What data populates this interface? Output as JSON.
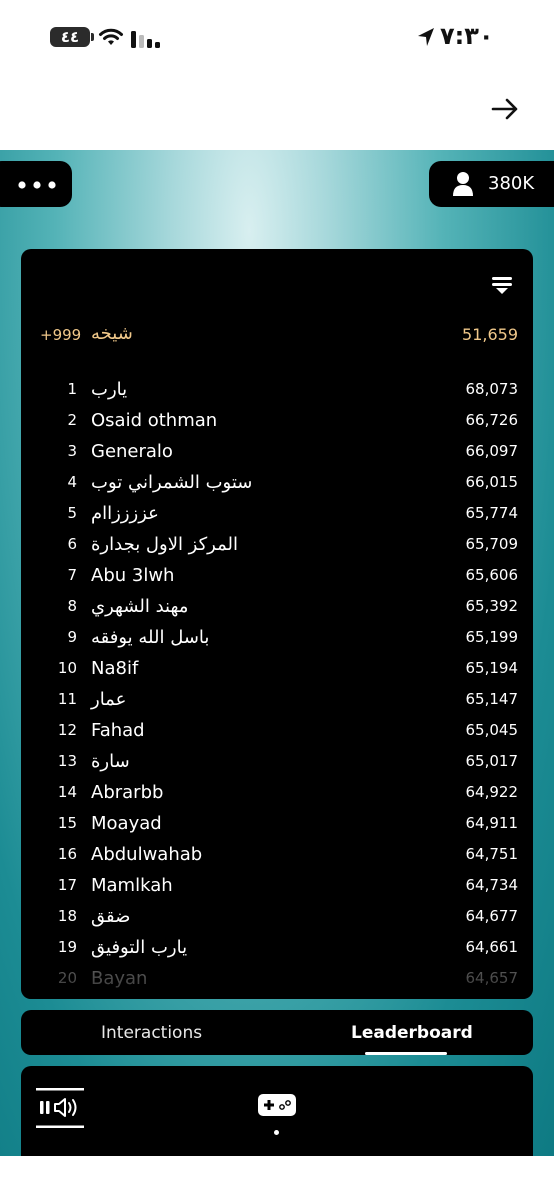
{
  "status_bar": {
    "battery": "٤٤",
    "time": "٧:٣٠"
  },
  "nav": {
    "forward_icon": "arrow-right-icon"
  },
  "header": {
    "more_icon": "ellipsis-icon",
    "coins_icon": "user-icon",
    "coins": "380K"
  },
  "leaderboard": {
    "sort_icon": "sort-filter-icon",
    "me": {
      "rank": "+999",
      "name": "شيخه",
      "score": "51,659"
    },
    "rows": [
      {
        "rank": "1",
        "name": "يارب",
        "score": "68,073"
      },
      {
        "rank": "2",
        "name": "Osaid othman",
        "score": "66,726"
      },
      {
        "rank": "3",
        "name": "Generalo",
        "score": "66,097"
      },
      {
        "rank": "4",
        "name": "ستوب الشمراني توب",
        "score": "66,015"
      },
      {
        "rank": "5",
        "name": "عززززاام",
        "score": "65,774"
      },
      {
        "rank": "6",
        "name": "المركز الاول بجدارة",
        "score": "65,709"
      },
      {
        "rank": "7",
        "name": "Abu 3lwh",
        "score": "65,606"
      },
      {
        "rank": "8",
        "name": "مهند الشهري",
        "score": "65,392"
      },
      {
        "rank": "9",
        "name": "باسل الله يوفقه",
        "score": "65,199"
      },
      {
        "rank": "10",
        "name": "Na8if",
        "score": "65,194"
      },
      {
        "rank": "11",
        "name": "عمار",
        "score": "65,147"
      },
      {
        "rank": "12",
        "name": "Fahad",
        "score": "65,045"
      },
      {
        "rank": "13",
        "name": "سارة",
        "score": "65,017"
      },
      {
        "rank": "14",
        "name": "Abrarbb",
        "score": "64,922"
      },
      {
        "rank": "15",
        "name": "Moayad",
        "score": "64,911"
      },
      {
        "rank": "16",
        "name": "Abdulwahab",
        "score": "64,751"
      },
      {
        "rank": "17",
        "name": "Mamlkah",
        "score": "64,734"
      },
      {
        "rank": "18",
        "name": "ضقق",
        "score": "64,677"
      },
      {
        "rank": "19",
        "name": "يارب التوفيق",
        "score": "64,661"
      },
      {
        "rank": "20",
        "name": "Bayan",
        "score": "64,657"
      }
    ]
  },
  "tabs": [
    {
      "label": "Interactions",
      "active": false
    },
    {
      "label": "Leaderboard",
      "active": true
    }
  ],
  "game_bar": {
    "audio_icon": "pause-volume-icon",
    "game_icon": "gamepad-icon"
  }
}
